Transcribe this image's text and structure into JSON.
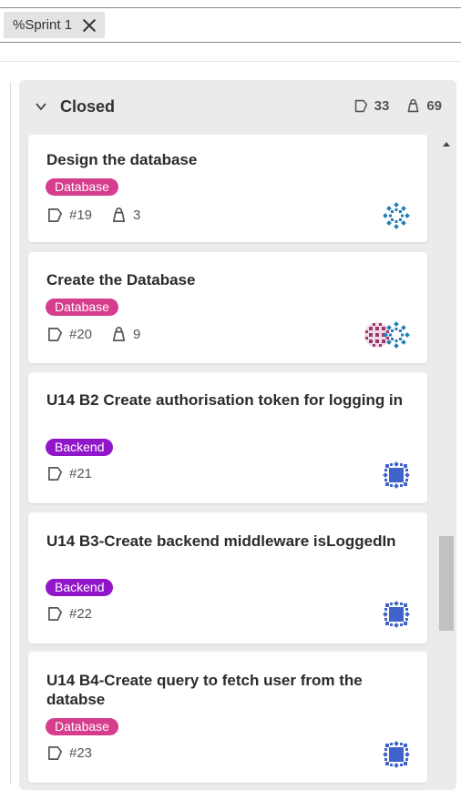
{
  "filter": {
    "chip_label": "%Sprint 1"
  },
  "column": {
    "title": "Closed",
    "stories_count": "33",
    "tasks_count": "69"
  },
  "colors": {
    "database_tag": "#d63d8c",
    "backend_tag": "#9216c9",
    "avatar_teal": "#1f7fb8",
    "avatar_blue": "#3f63c9",
    "avatar_maroon": "#9b3a6b"
  },
  "cards": [
    {
      "title": "Design the database",
      "tag": "Database",
      "ref": "#19",
      "tasks": "3",
      "avatars": [
        "teal-diamond"
      ]
    },
    {
      "title": "Create the Database",
      "tag": "Database",
      "ref": "#20",
      "tasks": "9",
      "avatars": [
        "maroon-grid",
        "teal-diamond"
      ]
    },
    {
      "title": "U14 B2 Create authorisation token for logging in",
      "tag": "Backend",
      "ref": "#21",
      "avatars": [
        "blue-square"
      ]
    },
    {
      "title": "U14 B3-Create backend middleware isLoggedIn",
      "tag": "Backend",
      "ref": "#22",
      "avatars": [
        "blue-square"
      ]
    },
    {
      "title": "U14 B4-Create query to fetch user from the databse",
      "tag": "Database",
      "ref": "#23",
      "avatars": [
        "blue-square"
      ]
    }
  ]
}
